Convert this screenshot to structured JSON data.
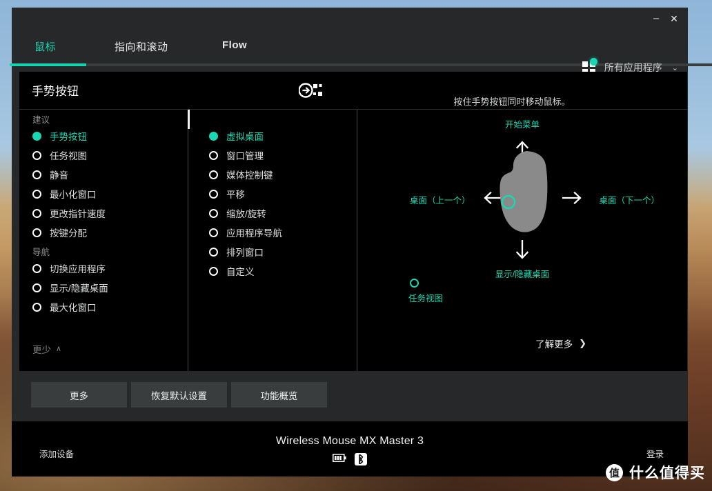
{
  "window": {
    "minimize_label": "–",
    "close_label": "✕"
  },
  "tabs": [
    {
      "label": "鼠标",
      "active": true
    },
    {
      "label": "指向和滚动",
      "active": false
    },
    {
      "label": "Flow",
      "active": false
    }
  ],
  "app_selector": {
    "icon": "app-grid-icon",
    "label": "所有应用程序",
    "chevron": "⌄"
  },
  "panel": {
    "title": "手势按钮",
    "head_icon": "gesture-assign-icon",
    "hint": "按住手势按钮同时移动鼠标。"
  },
  "left_column": {
    "group_suggested": "建议",
    "group_navigation": "导航",
    "suggested_items": [
      {
        "label": "手势按钮",
        "selected": true
      },
      {
        "label": "任务视图",
        "selected": false
      },
      {
        "label": "静音",
        "selected": false
      },
      {
        "label": "最小化窗口",
        "selected": false
      },
      {
        "label": "更改指针速度",
        "selected": false
      },
      {
        "label": "按键分配",
        "selected": false
      }
    ],
    "navigation_items": [
      {
        "label": "切换应用程序",
        "selected": false
      },
      {
        "label": "显示/隐藏桌面",
        "selected": false
      },
      {
        "label": "最大化窗口",
        "selected": false
      }
    ],
    "more_less_label": "更少",
    "more_less_caret": "∧"
  },
  "middle_column": {
    "items": [
      {
        "label": "虚拟桌面",
        "selected": true
      },
      {
        "label": "窗口管理",
        "selected": false
      },
      {
        "label": "媒体控制键",
        "selected": false
      },
      {
        "label": "平移",
        "selected": false
      },
      {
        "label": "缩放/旋转",
        "selected": false
      },
      {
        "label": "应用程序导航",
        "selected": false
      },
      {
        "label": "排列窗口",
        "selected": false
      },
      {
        "label": "自定义",
        "selected": false
      }
    ]
  },
  "diagram": {
    "up_label": "开始菜单",
    "down_label": "显示/隐藏桌面",
    "left_label": "桌面（上一个）",
    "right_label": "桌面（下一个）",
    "press_label": "任务视图",
    "learn_more": "了解更多",
    "learn_more_caret": "❯",
    "mouse_color": "#8a8a8a",
    "accent_color": "#19d7b2"
  },
  "action_buttons": [
    {
      "label": "更多"
    },
    {
      "label": "恢复默认设置"
    },
    {
      "label": "功能概览"
    }
  ],
  "bottom_bar": {
    "add_device": "添加设备",
    "sign_in": "登录",
    "device_name": "Wireless Mouse MX Master 3",
    "battery_icon": "battery-icon",
    "bluetooth_icon": "bluetooth-icon"
  },
  "watermark": {
    "logo": "值",
    "text": "什么值得买"
  }
}
